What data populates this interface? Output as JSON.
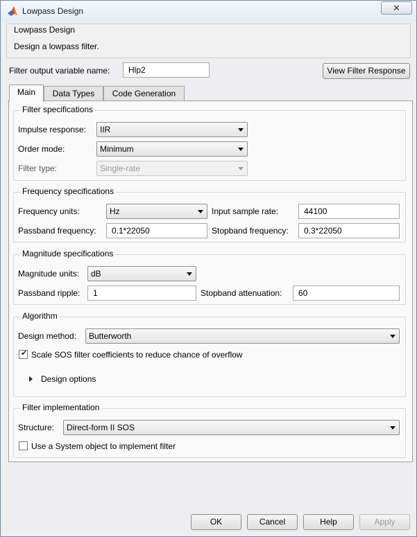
{
  "window": {
    "title": "Lowpass Design",
    "close_label": "✕",
    "icon": "matlab-logo-icon"
  },
  "header": {
    "title": "Lowpass Design",
    "description": "Design a lowpass filter."
  },
  "output_var": {
    "label": "Filter output variable name:",
    "value": "Hlp2"
  },
  "view_response_button": "View Filter Response",
  "tabs": [
    {
      "label": "Main",
      "active": true
    },
    {
      "label": "Data Types",
      "active": false
    },
    {
      "label": "Code Generation",
      "active": false
    }
  ],
  "filter_specs": {
    "title": "Filter specifications",
    "impulse_label": "Impulse response:",
    "impulse_value": "IIR",
    "order_label": "Order mode:",
    "order_value": "Minimum",
    "type_label": "Filter type:",
    "type_value": "Single-rate"
  },
  "freq_specs": {
    "title": "Frequency specifications",
    "units_label": "Frequency units:",
    "units_value": "Hz",
    "rate_label": "Input sample rate:",
    "rate_value": "44100",
    "passband_label": "Passband frequency:",
    "passband_value": "0.1*22050",
    "stopband_label": "Stopband frequency:",
    "stopband_value": "0.3*22050"
  },
  "mag_specs": {
    "title": "Magnitude specifications",
    "units_label": "Magnitude units:",
    "units_value": "dB",
    "ripple_label": "Passband ripple:",
    "ripple_value": "1",
    "atten_label": "Stopband attenuation:",
    "atten_value": "60"
  },
  "algorithm": {
    "title": "Algorithm",
    "method_label": "Design method:",
    "method_value": "Butterworth",
    "scale_label": "Scale SOS filter coefficients to reduce chance of overflow",
    "scale_checked": true,
    "options_label": "Design options"
  },
  "implementation": {
    "title": "Filter implementation",
    "structure_label": "Structure:",
    "structure_value": "Direct-form II SOS",
    "system_object_label": "Use a System object to implement filter",
    "system_object_checked": false
  },
  "footer": {
    "ok": "OK",
    "cancel": "Cancel",
    "help": "Help",
    "apply": "Apply"
  }
}
